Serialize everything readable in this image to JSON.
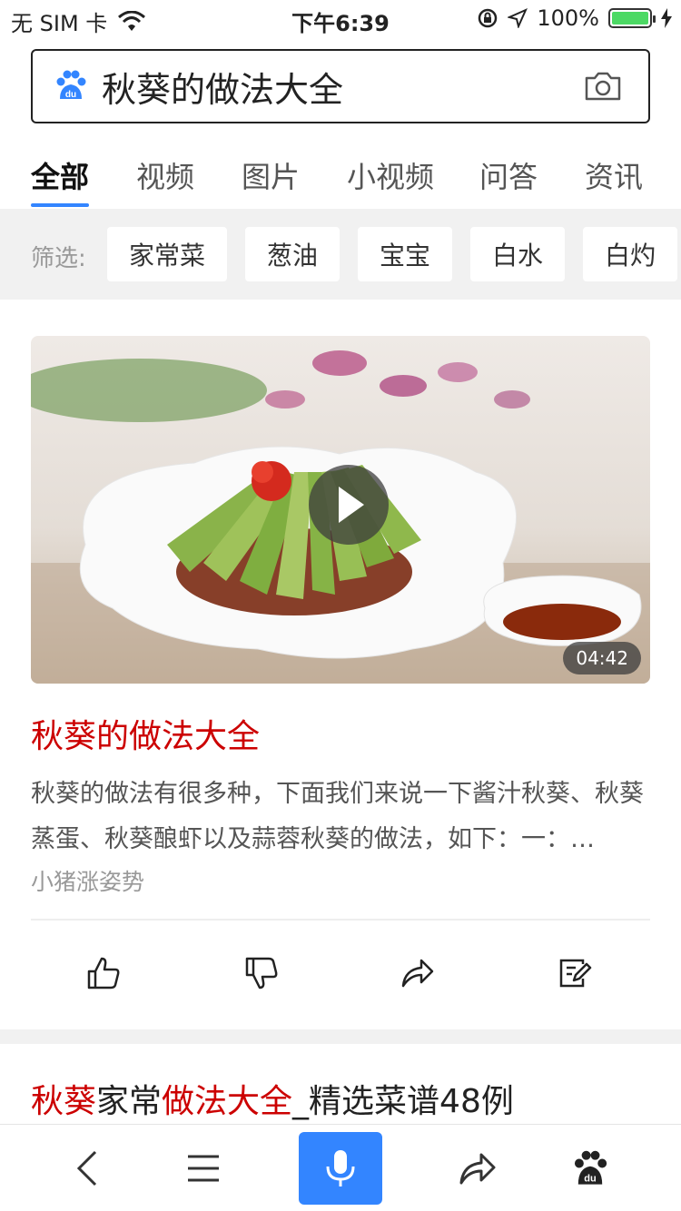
{
  "status_bar": {
    "carrier": "无 SIM 卡",
    "time": "下午6:39",
    "battery": "100%"
  },
  "search": {
    "query": "秋葵的做法大全"
  },
  "tabs": [
    {
      "label": "全部",
      "active": true
    },
    {
      "label": "视频"
    },
    {
      "label": "图片"
    },
    {
      "label": "小视频"
    },
    {
      "label": "问答"
    },
    {
      "label": "资讯"
    }
  ],
  "filter": {
    "label": "筛选:",
    "chips": [
      "家常菜",
      "葱油",
      "宝宝",
      "白水",
      "白灼"
    ]
  },
  "result1": {
    "duration": "04:42",
    "title": "秋葵的做法大全",
    "desc": "秋葵的做法有很多种，下面我们来说一下酱汁秋葵、秋葵蒸蛋、秋葵酿虾以及蒜蓉秋葵的做法，如下：一：…",
    "source": "小猪涨姿势"
  },
  "result2": {
    "title_a": "秋葵",
    "title_b": "家常",
    "title_c": "做法大全",
    "title_d": "_精选菜谱48例"
  },
  "colors": {
    "accent": "#3385ff",
    "title_red": "#cc0000"
  }
}
